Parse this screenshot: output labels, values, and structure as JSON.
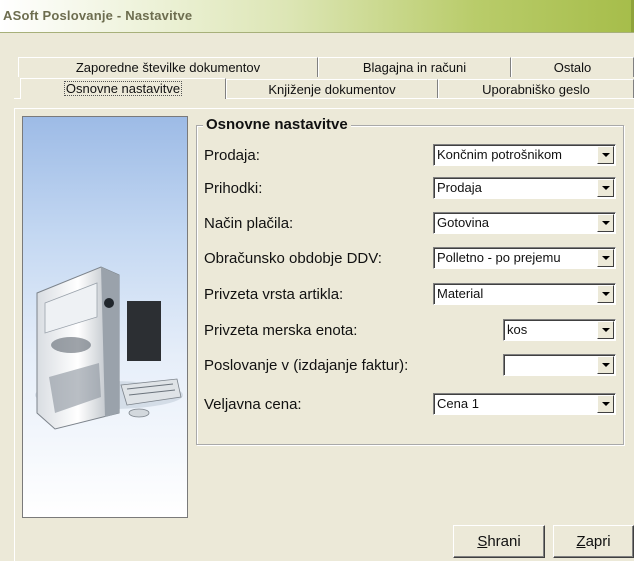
{
  "window": {
    "title": "ASoft Poslovanje - Nastavitve"
  },
  "tabs": {
    "row_back": [
      "Zaporedne številke dokumentov",
      "Blagajna in računi",
      "Ostalo"
    ],
    "row_front": [
      "Osnovne nastavitve",
      "Knjiženje dokumentov",
      "Uporabniško geslo"
    ],
    "active": "Osnovne nastavitve"
  },
  "group": {
    "title": "Osnovne nastavitve",
    "fields": [
      {
        "label": "Prodaja:",
        "value": "Končnim potrošnikom"
      },
      {
        "label": "Prihodki:",
        "value": "Prodaja"
      },
      {
        "label": "Način plačila:",
        "value": "Gotovina"
      },
      {
        "label": "Obračunsko obdobje DDV:",
        "value": "Polletno - po prejemu"
      },
      {
        "label": "Privzeta vrsta artikla:",
        "value": "Material"
      },
      {
        "label": "Privzeta merska enota:",
        "value": "kos"
      },
      {
        "label": "Poslovanje v (izdajanje faktur):",
        "value": ""
      },
      {
        "label": "Veljavna cena:",
        "value": "Cena 1"
      }
    ]
  },
  "buttons": {
    "save": {
      "first": "S",
      "rest": "hrani"
    },
    "close": {
      "first": "Z",
      "rest": "apri"
    }
  },
  "image": {
    "icon": "desktop-computer-icon"
  }
}
